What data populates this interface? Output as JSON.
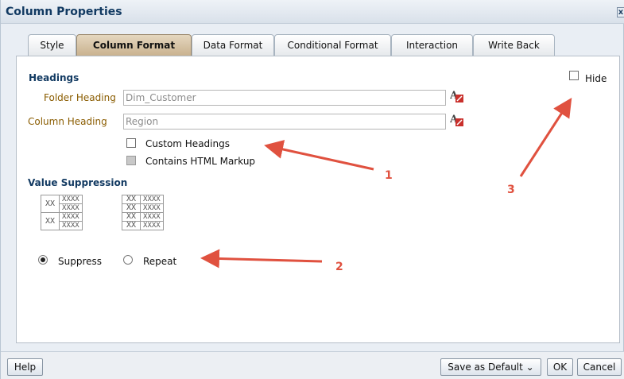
{
  "dialog": {
    "title": "Column Properties",
    "close_label": "x"
  },
  "tabs": [
    {
      "label": "Style"
    },
    {
      "label": "Column Format",
      "active": true
    },
    {
      "label": "Data Format"
    },
    {
      "label": "Conditional Format"
    },
    {
      "label": "Interaction"
    },
    {
      "label": "Write Back"
    }
  ],
  "headings": {
    "section_title": "Headings",
    "folder_heading_label": "Folder Heading",
    "folder_heading_value": "Dim_Customer",
    "column_heading_label": "Column Heading",
    "column_heading_value": "Region",
    "custom_headings_label": "Custom Headings",
    "custom_headings_checked": false,
    "html_markup_label": "Contains HTML Markup",
    "html_markup_checked": false,
    "html_markup_enabled": false,
    "hide_label": "Hide",
    "hide_checked": false
  },
  "value_suppression": {
    "section_title": "Value Suppression",
    "preview_merged": [
      "XX",
      "XX"
    ],
    "preview_repeat": [
      "XX",
      "XX",
      "XX",
      "XX"
    ],
    "preview_values": [
      "XXXX",
      "XXXX",
      "XXXX",
      "XXXX"
    ],
    "suppress_label": "Suppress",
    "repeat_label": "Repeat",
    "selected": "Suppress"
  },
  "footer": {
    "help_label": "Help",
    "save_default_label": "Save as Default ⌄",
    "ok_label": "OK",
    "cancel_label": "Cancel"
  },
  "annotations": {
    "one": "1",
    "two": "2",
    "three": "3"
  },
  "colors": {
    "annotation": "#e0513f",
    "label_brown": "#8a5c00",
    "title_blue": "#123a62",
    "active_tab": "#c9b28f"
  },
  "icons": {
    "font_format": "font-format-icon",
    "close": "close-icon"
  }
}
